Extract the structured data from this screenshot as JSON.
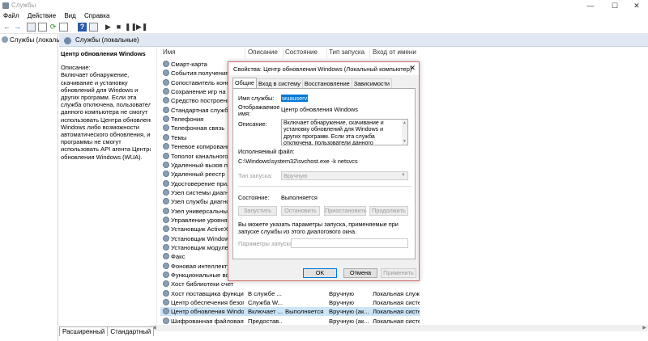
{
  "window": {
    "title": "Службы",
    "min": "—",
    "max": "☐",
    "close": "✕"
  },
  "menu": [
    "Файл",
    "Действие",
    "Вид",
    "Справка"
  ],
  "toolbar_icons": [
    "back-icon",
    "forward-icon",
    "console-icon",
    "properties-icon",
    "refresh-icon",
    "export-icon",
    "help-icon",
    "view-icon",
    "play-icon",
    "stop-icon",
    "pause-icon",
    "restart-icon"
  ],
  "tree": {
    "root_label": "Службы (локальны"
  },
  "header": {
    "title": "Службы (локальные)"
  },
  "details": {
    "title": "Центр обновления Windows",
    "desc_label": "Описание:",
    "desc_text": "Включает обнаружение, скачивание и установку обновлений для Windows и других программ. Если эта служба отключена, пользователи данного компьютера не смогут использовать Центра обновления Windows либо возможности автоматического обновления, и программы не смогут использовать API агента Центра обновления Windows (WUA)."
  },
  "columns": {
    "name": "Имя",
    "description": "Описание",
    "status": "Состояние",
    "startup": "Тип запуска",
    "logon": "Вход от имени"
  },
  "services": [
    {
      "name": "Смарт-карта",
      "desc": "",
      "status": "",
      "startup": "",
      "logon": ""
    },
    {
      "name": "События получения",
      "desc": "",
      "status": "",
      "startup": "",
      "logon": ""
    },
    {
      "name": "Сопоставитель конеч",
      "desc": "",
      "status": "",
      "startup": "",
      "logon": ""
    },
    {
      "name": "Сохранение игр на Xb",
      "desc": "",
      "status": "",
      "startup": "",
      "logon": ""
    },
    {
      "name": "Средство построения",
      "desc": "",
      "status": "",
      "startup": "",
      "logon": ""
    },
    {
      "name": "Стандартная служба с",
      "desc": "",
      "status": "",
      "startup": "",
      "logon": ""
    },
    {
      "name": "Телефония",
      "desc": "",
      "status": "",
      "startup": "",
      "logon": ""
    },
    {
      "name": "Телефонная связь",
      "desc": "",
      "status": "",
      "startup": "",
      "logon": ""
    },
    {
      "name": "Темы",
      "desc": "",
      "status": "",
      "startup": "",
      "logon": ""
    },
    {
      "name": "Теневое копирование",
      "desc": "",
      "status": "",
      "startup": "",
      "logon": ""
    },
    {
      "name": "Тополог канального у",
      "desc": "",
      "status": "",
      "startup": "",
      "logon": ""
    },
    {
      "name": "Удаленный вызов про",
      "desc": "",
      "status": "",
      "startup": "",
      "logon": ""
    },
    {
      "name": "Удаленный реестр",
      "desc": "",
      "status": "",
      "startup": "",
      "logon": ""
    },
    {
      "name": "Удостоверение прилс",
      "desc": "",
      "status": "",
      "startup": "",
      "logon": ""
    },
    {
      "name": "Узел системы диагно",
      "desc": "",
      "status": "",
      "startup": "",
      "logon": ""
    },
    {
      "name": "Узел службы диагнос",
      "desc": "",
      "status": "",
      "startup": "",
      "logon": ""
    },
    {
      "name": "Узел универсальных Р",
      "desc": "",
      "status": "",
      "startup": "",
      "logon": ""
    },
    {
      "name": "Управление уровнями",
      "desc": "",
      "status": "",
      "startup": "",
      "logon": ""
    },
    {
      "name": "Установщик ActiveX (",
      "desc": "",
      "status": "",
      "startup": "",
      "logon": ""
    },
    {
      "name": "Установщик Windows",
      "desc": "",
      "status": "",
      "startup": "",
      "logon": ""
    },
    {
      "name": "Установщик модулей",
      "desc": "",
      "status": "",
      "startup": "",
      "logon": ""
    },
    {
      "name": "Факс",
      "desc": "",
      "status": "",
      "startup": "",
      "logon": ""
    },
    {
      "name": "Фоновая интеллектуа",
      "desc": "",
      "status": "",
      "startup": "",
      "logon": ""
    },
    {
      "name": "Функциональные возм",
      "desc": "",
      "status": "",
      "startup": "",
      "logon": ""
    },
    {
      "name": "Хост библиотеки счет",
      "desc": "",
      "status": "",
      "startup": "",
      "logon": ""
    },
    {
      "name": "Хост поставщика функци...",
      "desc": "В службе ...",
      "status": "",
      "startup": "Вручную",
      "logon": "Локальная служба"
    },
    {
      "name": "Центр обеспечения безоп...",
      "desc": "Служба W...",
      "status": "",
      "startup": "Вручную",
      "logon": "Локальная система"
    },
    {
      "name": "Центр обновления Windows",
      "desc": "Включает ...",
      "status": "Выполняется",
      "startup": "Вручную (ак...",
      "logon": "Локальная система",
      "selected": true
    },
    {
      "name": "Шифрованная файловая с...",
      "desc": "Предостав...",
      "status": "",
      "startup": "Вручную (ак...",
      "logon": "Локальная система"
    }
  ],
  "bottom_tabs": [
    "Расширенный",
    "Стандартный"
  ],
  "dialog": {
    "title": "Свойства: Центр обновления Windows (Локальный компьютер)",
    "close": "✕",
    "tabs": [
      "Общие",
      "Вход в систему",
      "Восстановление",
      "Зависимости"
    ],
    "service_name_label": "Имя службы:",
    "service_name": "wuauserv",
    "display_name_label": "Отображаемое имя:",
    "display_name": "Центр обновления Windows",
    "description_label": "Описание:",
    "description": "Включает обнаружение, скачивание и установку обновлений для Windows и других программ. Если эта служба отключена, пользователи данного компьютера не смогут использовать",
    "exe_label": "Исполняемый файл:",
    "exe_path": "C:\\Windows\\system32\\svchost.exe -k netsvcs",
    "startup_label": "Тип запуска:",
    "startup_value": "Вручную",
    "status_label": "Состояние:",
    "status_value": "Выполняется",
    "btn_start": "Запустить",
    "btn_stop": "Остановить",
    "btn_pause": "Приостановить",
    "btn_resume": "Продолжить",
    "hint": "Вы можете указать параметры запуска, применяемые при запуске службы из этого диалогового окна.",
    "params_label": "Параметры запуска:",
    "params_value": "",
    "ok": "OK",
    "cancel": "Отмена",
    "apply": "Применить"
  }
}
